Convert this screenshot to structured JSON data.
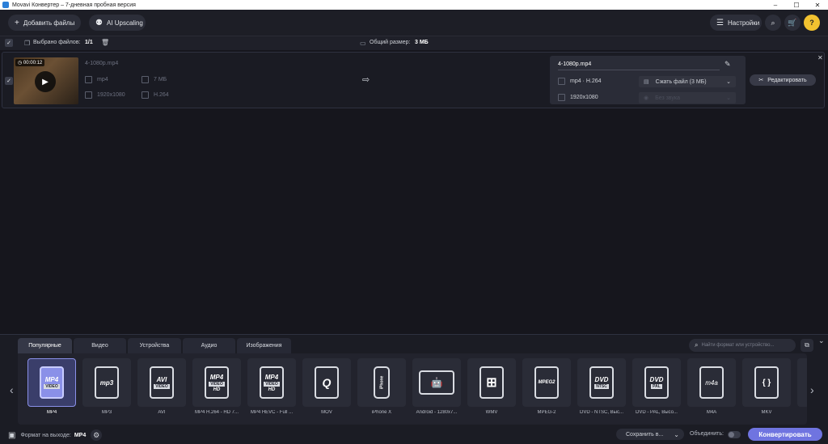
{
  "window": {
    "title": "Movavi Конвертер – 7-дневная пробная версия"
  },
  "toolbar": {
    "add_files": "Добавить файлы",
    "ai_upscaling": "AI Upscaling",
    "settings": "Настройки"
  },
  "selection": {
    "selected_label": "Выбрано файлов:",
    "selected_value": "1/1",
    "total_label": "Общий размер:",
    "total_value": "3 МБ"
  },
  "file": {
    "duration": "00:00:12",
    "name": "4-1080p.mp4",
    "container": "mp4",
    "size": "7 МБ",
    "resolution": "1920x1080",
    "codec": "H.264"
  },
  "output": {
    "name": "4-1080p.mp4",
    "format": "mp4 · H.264",
    "compress": "Сжать файл (3 МБ)",
    "resolution": "1920x1080",
    "no_subs": "Без звука",
    "edit": "Редактировать"
  },
  "tabs": [
    {
      "label": "Популярные"
    },
    {
      "label": "Видео"
    },
    {
      "label": "Устройства"
    },
    {
      "label": "Аудио"
    },
    {
      "label": "Изображения"
    }
  ],
  "search": {
    "placeholder": "Найти формат или устройство..."
  },
  "formats": [
    {
      "label": "MP4",
      "main": "MP4",
      "sub": "VIDEO",
      "hd": ""
    },
    {
      "label": "MP3",
      "main": "mp3",
      "sub": "",
      "hd": ""
    },
    {
      "label": "AVI",
      "main": "AVI",
      "sub": "VIDEO",
      "hd": ""
    },
    {
      "label": "MP4 H.264 - HD 7...",
      "main": "MP4",
      "sub": "VIDEO",
      "hd": "HD"
    },
    {
      "label": "MP4 HEVC - Full ...",
      "main": "MP4",
      "sub": "VIDEO",
      "hd": "HD"
    },
    {
      "label": "MOV",
      "main": "Q",
      "sub": "",
      "hd": ""
    },
    {
      "label": "iPhone X",
      "main": "iPhone",
      "sub": "",
      "hd": ""
    },
    {
      "label": "Android - 1280x7...",
      "main": "🤖",
      "sub": "",
      "hd": ""
    },
    {
      "label": "WMV",
      "main": "⊞",
      "sub": "",
      "hd": ""
    },
    {
      "label": "MPEG-2",
      "main": "MPEG2",
      "sub": "",
      "hd": ""
    },
    {
      "label": "DVD - NTSC, Выс...",
      "main": "DVD",
      "sub": "NTSC",
      "hd": ""
    },
    {
      "label": "DVD - PAL, Высо...",
      "main": "DVD",
      "sub": "PAL",
      "hd": ""
    },
    {
      "label": "M4A",
      "main": "m4a",
      "sub": "",
      "hd": ""
    },
    {
      "label": "MKV",
      "main": "{ }",
      "sub": "",
      "hd": ""
    }
  ],
  "status": {
    "output_label": "Формат на выходе:",
    "output_value": "MP4",
    "save": "Сохранить в...",
    "merge": "Объединить:",
    "convert": "Конвертировать"
  },
  "colors": {
    "accent": "#6f74e0",
    "background": "#16161d",
    "panel": "#2a2c37"
  }
}
